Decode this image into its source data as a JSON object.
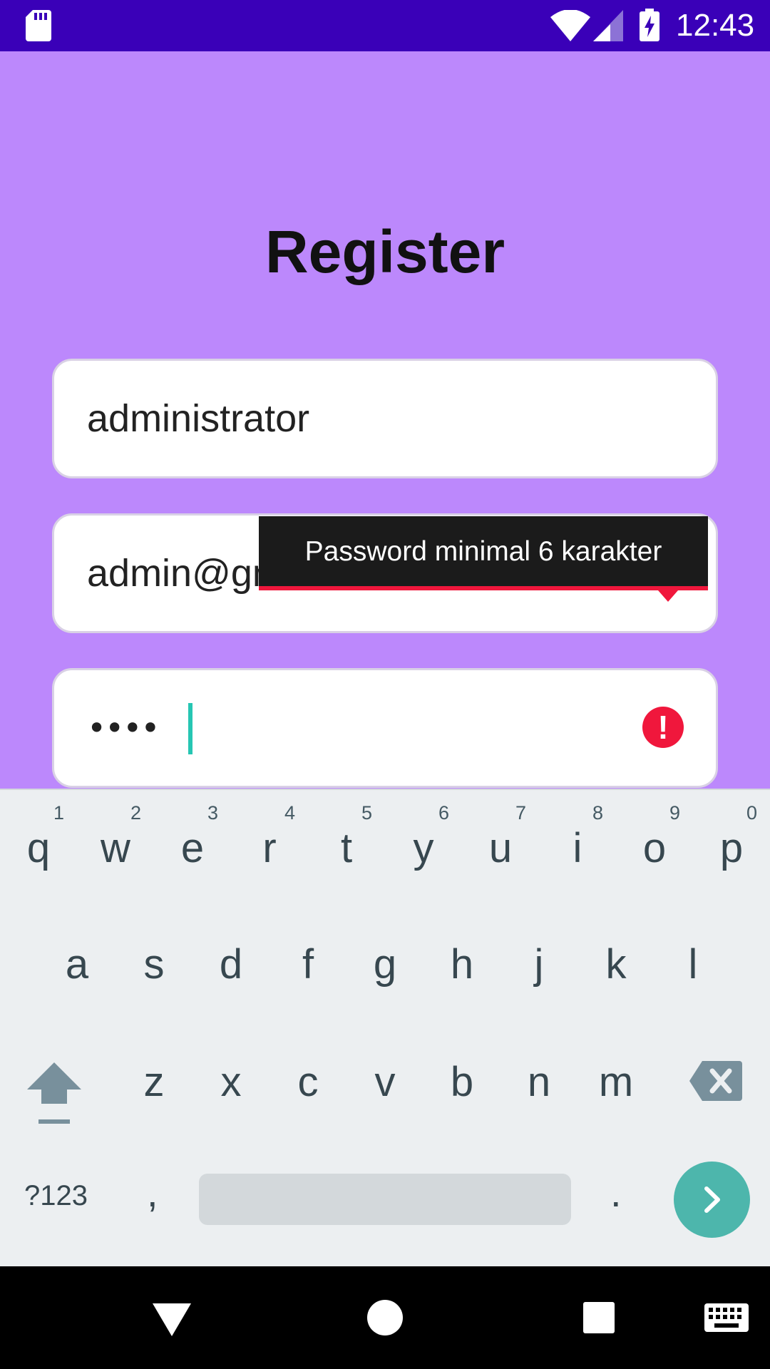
{
  "status_bar": {
    "time": "12:43",
    "icons": [
      "sd-card-icon",
      "wifi-icon",
      "cell-signal-icon",
      "battery-charging-icon"
    ],
    "background": "#3a00b8"
  },
  "app": {
    "background": "#bc88fc",
    "title": "Register"
  },
  "form": {
    "username_value": "administrator",
    "email_value": "admin@gmail.com",
    "password_mask": "••••",
    "error_tooltip": "Password minimal 6 karakter",
    "error_color": "#f0173c"
  },
  "keyboard": {
    "row1": [
      {
        "ch": "q",
        "num": "1"
      },
      {
        "ch": "w",
        "num": "2"
      },
      {
        "ch": "e",
        "num": "3"
      },
      {
        "ch": "r",
        "num": "4"
      },
      {
        "ch": "t",
        "num": "5"
      },
      {
        "ch": "y",
        "num": "6"
      },
      {
        "ch": "u",
        "num": "7"
      },
      {
        "ch": "i",
        "num": "8"
      },
      {
        "ch": "o",
        "num": "9"
      },
      {
        "ch": "p",
        "num": "0"
      }
    ],
    "row2": [
      "a",
      "s",
      "d",
      "f",
      "g",
      "h",
      "j",
      "k",
      "l"
    ],
    "row3": [
      "z",
      "x",
      "c",
      "v",
      "b",
      "n",
      "m"
    ],
    "symbols_label": "?123",
    "comma": ",",
    "period": ".",
    "enter_color": "#4db6ac"
  },
  "nav_bar": {
    "buttons": [
      "back-icon",
      "home-icon",
      "recents-icon",
      "keyboard-switch-icon"
    ]
  }
}
